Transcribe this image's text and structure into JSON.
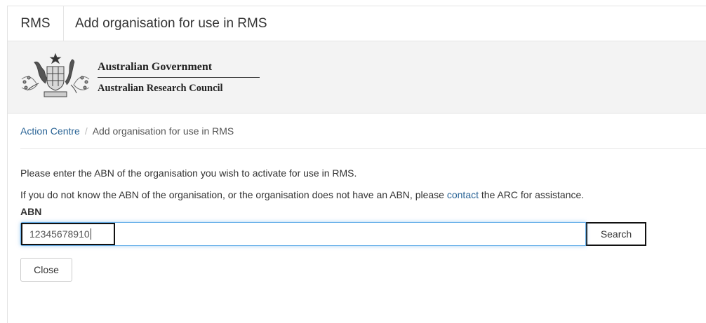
{
  "titlebar": {
    "app_name": "RMS",
    "title": "Add organisation for use in RMS"
  },
  "banner": {
    "crest_icon": "australian-coat-of-arms",
    "line1": "Australian Government",
    "line2": "Australian Research Council"
  },
  "breadcrumb": {
    "items": [
      {
        "label": "Action Centre",
        "link": true
      },
      {
        "label": "Add organisation for use in RMS",
        "link": false
      }
    ],
    "separator": "/"
  },
  "instructions": {
    "line1": "Please enter the ABN of the organisation you wish to activate for use in RMS.",
    "line2_before": "If you do not know the ABN of the organisation, or the organisation does not have an ABN, please ",
    "line2_link": "contact",
    "line2_after": " the ARC for assistance."
  },
  "form": {
    "abn_label": "ABN",
    "abn_value": "12345678910",
    "search_label": "Search",
    "close_label": "Close"
  },
  "colors": {
    "link": "#2a6496",
    "banner_bg": "#f3f3f3",
    "input_focus": "#66afe9"
  }
}
